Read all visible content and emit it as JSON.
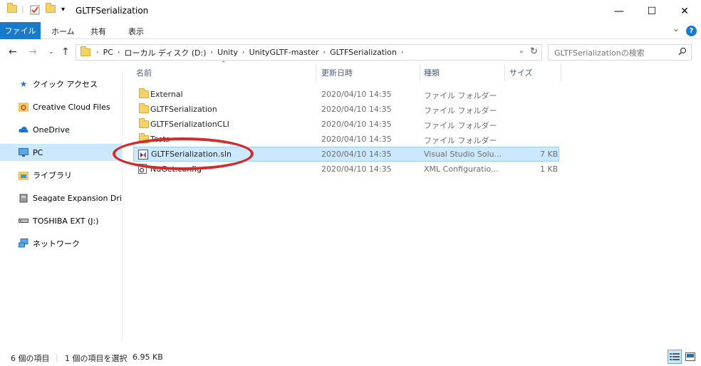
{
  "window": {
    "title": "GLTFSerialization",
    "minimize_label": "—",
    "maximize_label": "☐",
    "close_label": "✕"
  },
  "ribbon": {
    "tabs": [
      "ファイル",
      "ホーム",
      "共有",
      "表示"
    ],
    "expand_label": "⌄",
    "help_label": "?"
  },
  "address": {
    "crumbs": [
      "PC",
      "ローカル ディスク (D:)",
      "Unity",
      "UnityGLTF-master",
      "GLTFSerialization"
    ],
    "separator": "›"
  },
  "search": {
    "placeholder": "GLTFSerializationの検索"
  },
  "sidebar": {
    "items": [
      {
        "label": "クイック アクセス",
        "icon": "star-icon"
      },
      {
        "label": "Creative Cloud Files",
        "icon": "creative-cloud-icon"
      },
      {
        "label": "OneDrive",
        "icon": "cloud-icon"
      },
      {
        "label": "PC",
        "icon": "pc-icon",
        "selected": true
      },
      {
        "label": "ライブラリ",
        "icon": "library-icon"
      },
      {
        "label": "Seagate Expansion Drive",
        "icon": "drive-icon"
      },
      {
        "label": "TOSHIBA EXT (J:)",
        "icon": "usb-drive-icon"
      },
      {
        "label": "ネットワーク",
        "icon": "network-icon"
      }
    ]
  },
  "columns": {
    "name": "名前",
    "date": "更新日時",
    "type": "種類",
    "size": "サイズ"
  },
  "files": [
    {
      "name": "External",
      "date": "2020/04/10 14:35",
      "type": "ファイル フォルダー",
      "size": "",
      "kind": "folder"
    },
    {
      "name": "GLTFSerialization",
      "date": "2020/04/10 14:35",
      "type": "ファイル フォルダー",
      "size": "",
      "kind": "folder"
    },
    {
      "name": "GLTFSerializationCLI",
      "date": "2020/04/10 14:35",
      "type": "ファイル フォルダー",
      "size": "",
      "kind": "folder"
    },
    {
      "name": "Tests",
      "date": "2020/04/10 14:35",
      "type": "ファイル フォルダー",
      "size": "",
      "kind": "folder"
    },
    {
      "name": "GLTFSerialization.sln",
      "date": "2020/04/10 14:35",
      "type": "Visual Studio Solu...",
      "size": "7 KB",
      "kind": "sln",
      "selected": true
    },
    {
      "name": "NuGet.config",
      "date": "2020/04/10 14:35",
      "type": "XML Configuratio...",
      "size": "1 KB",
      "kind": "config"
    }
  ],
  "status": {
    "item_count": "6 個の項目",
    "selection": "1 個の項目を選択",
    "selection_size": "6.95 KB"
  },
  "colors": {
    "accent": "#1979ca",
    "selection": "#cce8ff",
    "highlight_circle": "#d32a2a"
  }
}
